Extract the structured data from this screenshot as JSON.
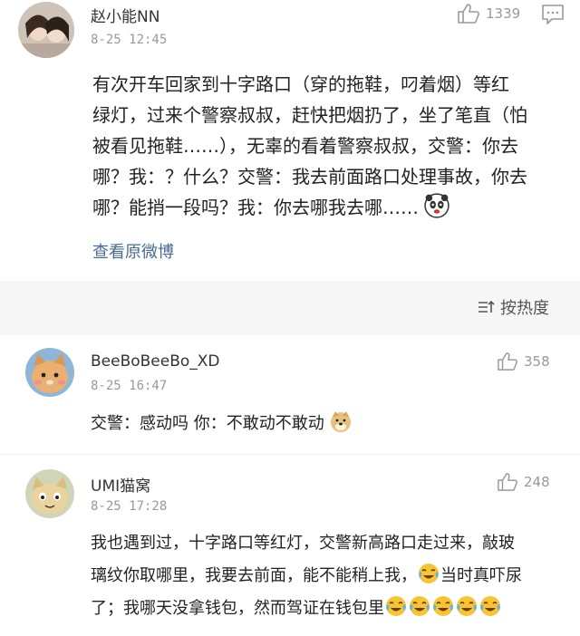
{
  "post": {
    "author": "赵小能NN",
    "time": "8-25 12:45",
    "likes": "1339",
    "lines": [
      "有次开车回家到十字路口（穿的拖鞋，叼着烟）等红",
      "绿灯，过来个警察叔叔，赶快把烟扔了，坐了笔直（怕",
      "被看见拖鞋……），无辜的看着警察叔叔，交警：你去",
      "哪？我：？什么？交警：我去前面路口处理事故，你去",
      "哪？能捎一段吗？我：你去哪我去哪……"
    ],
    "view_original": "查看原微博"
  },
  "sort": {
    "label": "按热度"
  },
  "comments": [
    {
      "author": "BeeBoBeeBo_XD",
      "time": "8-25 16:47",
      "likes": "358",
      "text": "交警：感动吗 你：不敢动不敢动"
    },
    {
      "author": "UMI猫窝",
      "time": "8-25 17:28",
      "likes": "248",
      "lines": [
        "我也遇到过，十字路口等红灯，交警新高路口走过来，敲玻",
        "璃纹你取哪里，我要去前面，能不能稍上我，",
        "了；我哪天没拿钱包，然而驾证在钱包里"
      ],
      "inline_tail": "当时真吓尿"
    }
  ]
}
